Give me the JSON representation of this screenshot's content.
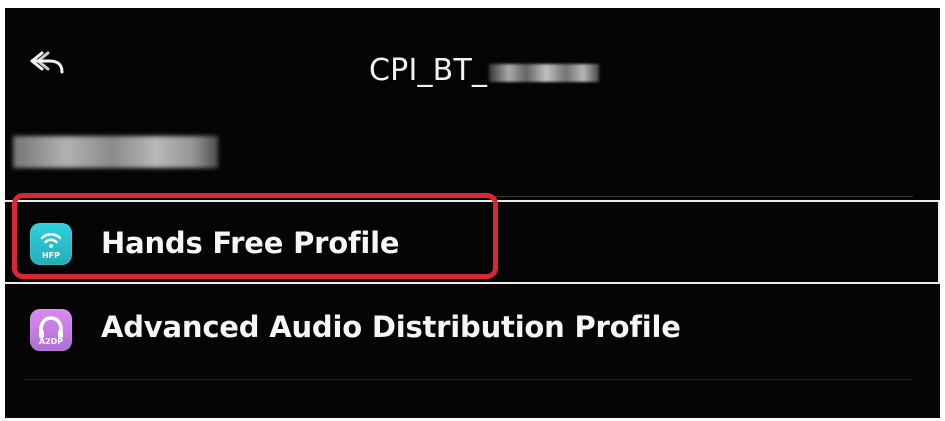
{
  "header": {
    "title": "CPI_BT_",
    "back_icon": "back-arrow-icon"
  },
  "profiles": [
    {
      "label": "Hands Free Profile",
      "icon": "hfp-icon",
      "icon_text": "HFP",
      "selected": true,
      "accent": "#2ed0db"
    },
    {
      "label": "Advanced Audio Distribution Profile",
      "icon": "a2dp-icon",
      "icon_text": "A2DP",
      "selected": false,
      "accent": "#d88af0"
    }
  ],
  "colors": {
    "background": "#050505",
    "text": "#f6f6f6",
    "highlight": "#da2637",
    "focus_border": "#ececec"
  }
}
